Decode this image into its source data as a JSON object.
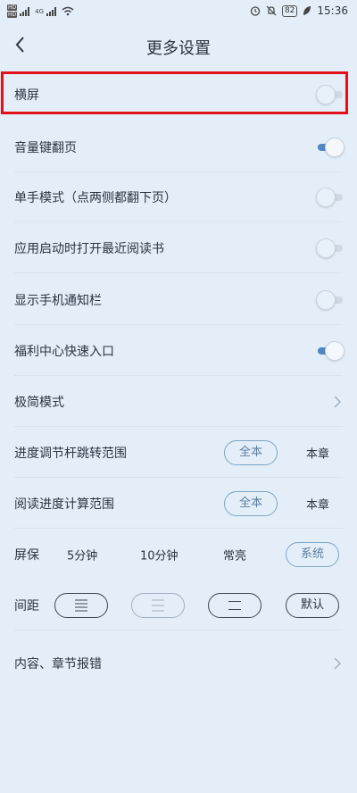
{
  "status_bar": {
    "left_badges": [
      "HD",
      "HD"
    ],
    "network": "4G",
    "time": "15:36",
    "battery": "82"
  },
  "header": {
    "title": "更多设置"
  },
  "settings": {
    "landscape": {
      "label": "横屏",
      "on": false
    },
    "volume_page": {
      "label": "音量键翻页",
      "on": true
    },
    "one_hand": {
      "label": "单手模式（点两侧都翻下页）",
      "on": false
    },
    "open_recent": {
      "label": "应用启动时打开最近阅读书",
      "on": false
    },
    "show_notification": {
      "label": "显示手机通知栏",
      "on": false
    },
    "welfare_entry": {
      "label": "福利中心快速入口",
      "on": true
    },
    "minimal_mode": {
      "label": "极简模式"
    },
    "progress_jump": {
      "label": "进度调节杆跳转范围",
      "options": [
        "全本",
        "本章"
      ],
      "selected": "全本"
    },
    "progress_calc": {
      "label": "阅读进度计算范围",
      "options": [
        "全本",
        "本章"
      ],
      "selected": "全本"
    },
    "screen_saver": {
      "label": "屏保",
      "options": [
        "5分钟",
        "10分钟",
        "常亮",
        "系统"
      ],
      "selected": "系统"
    },
    "spacing": {
      "label": "间距",
      "default_label": "默认"
    },
    "report_error": {
      "label": "内容、章节报错"
    }
  },
  "colors": {
    "accent": "#4f86c6",
    "highlight": "#e0111a",
    "background": "#e3eef9"
  }
}
